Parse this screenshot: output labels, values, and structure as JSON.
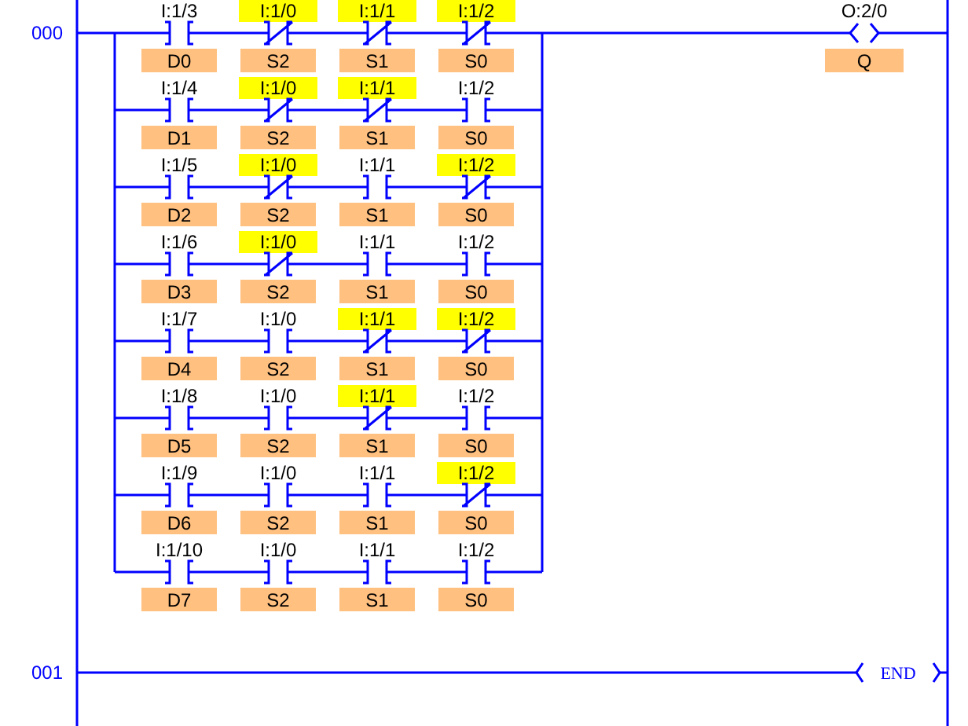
{
  "rungs": [
    {
      "number": "000",
      "branches": [
        {
          "contacts": [
            {
              "address": "I:1/3",
              "tag": "D0",
              "kind": "examine_on",
              "highlighted": false
            },
            {
              "address": "I:1/0",
              "tag": "S2",
              "kind": "examine_off",
              "highlighted": true
            },
            {
              "address": "I:1/1",
              "tag": "S1",
              "kind": "examine_off",
              "highlighted": true
            },
            {
              "address": "I:1/2",
              "tag": "S0",
              "kind": "examine_off",
              "highlighted": true
            }
          ]
        },
        {
          "contacts": [
            {
              "address": "I:1/4",
              "tag": "D1",
              "kind": "examine_on",
              "highlighted": false
            },
            {
              "address": "I:1/0",
              "tag": "S2",
              "kind": "examine_off",
              "highlighted": true
            },
            {
              "address": "I:1/1",
              "tag": "S1",
              "kind": "examine_off",
              "highlighted": true
            },
            {
              "address": "I:1/2",
              "tag": "S0",
              "kind": "examine_on",
              "highlighted": false
            }
          ]
        },
        {
          "contacts": [
            {
              "address": "I:1/5",
              "tag": "D2",
              "kind": "examine_on",
              "highlighted": false
            },
            {
              "address": "I:1/0",
              "tag": "S2",
              "kind": "examine_off",
              "highlighted": true
            },
            {
              "address": "I:1/1",
              "tag": "S1",
              "kind": "examine_on",
              "highlighted": false
            },
            {
              "address": "I:1/2",
              "tag": "S0",
              "kind": "examine_off",
              "highlighted": true
            }
          ]
        },
        {
          "contacts": [
            {
              "address": "I:1/6",
              "tag": "D3",
              "kind": "examine_on",
              "highlighted": false
            },
            {
              "address": "I:1/0",
              "tag": "S2",
              "kind": "examine_off",
              "highlighted": true
            },
            {
              "address": "I:1/1",
              "tag": "S1",
              "kind": "examine_on",
              "highlighted": false
            },
            {
              "address": "I:1/2",
              "tag": "S0",
              "kind": "examine_on",
              "highlighted": false
            }
          ]
        },
        {
          "contacts": [
            {
              "address": "I:1/7",
              "tag": "D4",
              "kind": "examine_on",
              "highlighted": false
            },
            {
              "address": "I:1/0",
              "tag": "S2",
              "kind": "examine_on",
              "highlighted": false
            },
            {
              "address": "I:1/1",
              "tag": "S1",
              "kind": "examine_off",
              "highlighted": true
            },
            {
              "address": "I:1/2",
              "tag": "S0",
              "kind": "examine_off",
              "highlighted": true
            }
          ]
        },
        {
          "contacts": [
            {
              "address": "I:1/8",
              "tag": "D5",
              "kind": "examine_on",
              "highlighted": false
            },
            {
              "address": "I:1/0",
              "tag": "S2",
              "kind": "examine_on",
              "highlighted": false
            },
            {
              "address": "I:1/1",
              "tag": "S1",
              "kind": "examine_off",
              "highlighted": true
            },
            {
              "address": "I:1/2",
              "tag": "S0",
              "kind": "examine_on",
              "highlighted": false
            }
          ]
        },
        {
          "contacts": [
            {
              "address": "I:1/9",
              "tag": "D6",
              "kind": "examine_on",
              "highlighted": false
            },
            {
              "address": "I:1/0",
              "tag": "S2",
              "kind": "examine_on",
              "highlighted": false
            },
            {
              "address": "I:1/1",
              "tag": "S1",
              "kind": "examine_on",
              "highlighted": false
            },
            {
              "address": "I:1/2",
              "tag": "S0",
              "kind": "examine_off",
              "highlighted": true
            }
          ]
        },
        {
          "contacts": [
            {
              "address": "I:1/10",
              "tag": "D7",
              "kind": "examine_on",
              "highlighted": false
            },
            {
              "address": "I:1/0",
              "tag": "S2",
              "kind": "examine_on",
              "highlighted": false
            },
            {
              "address": "I:1/1",
              "tag": "S1",
              "kind": "examine_on",
              "highlighted": false
            },
            {
              "address": "I:1/2",
              "tag": "S0",
              "kind": "examine_on",
              "highlighted": false
            }
          ]
        }
      ],
      "output": {
        "kind": "coil",
        "address": "O:2/0",
        "tag": "Q"
      }
    },
    {
      "number": "001",
      "output": {
        "kind": "end",
        "label": "END"
      }
    }
  ]
}
